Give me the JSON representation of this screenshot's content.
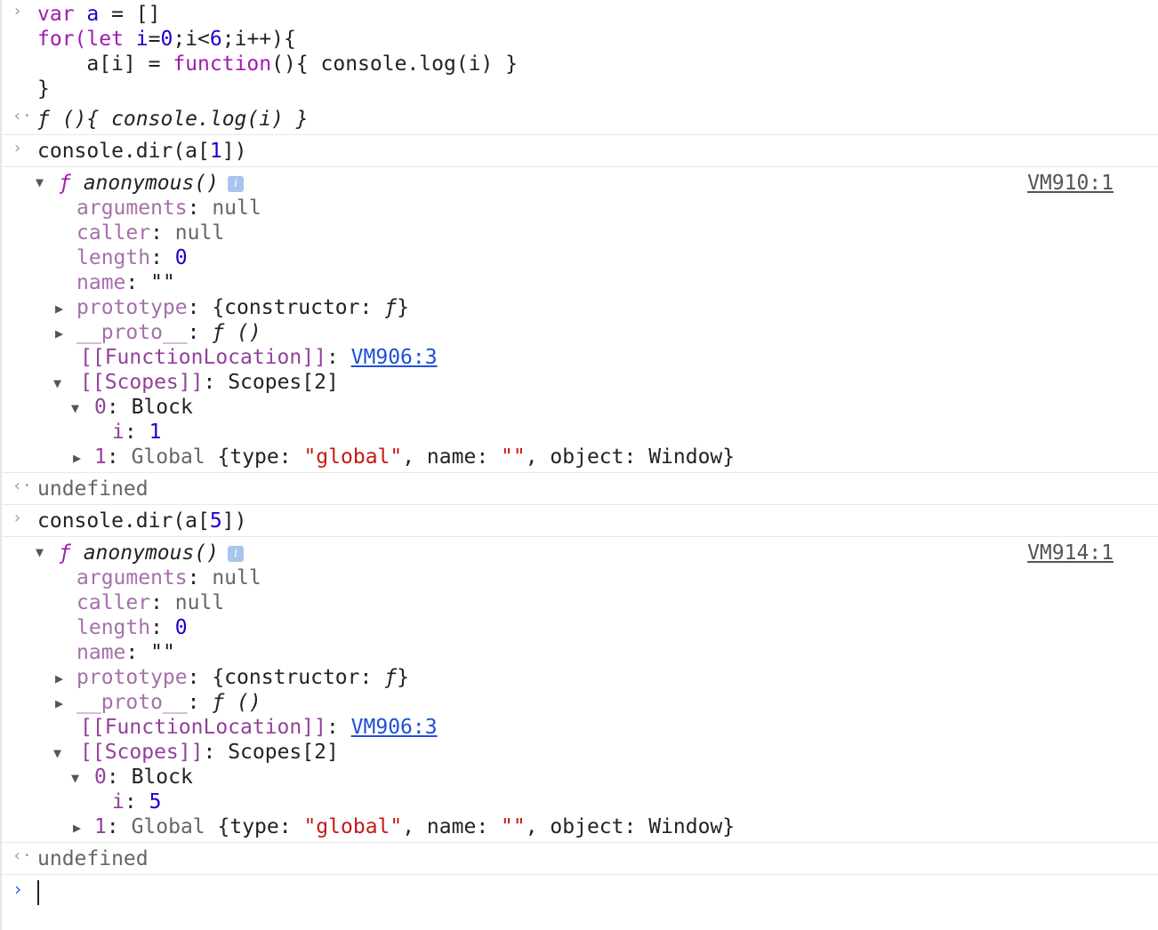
{
  "input1": {
    "l1": {
      "a": "var",
      "b": " a",
      "c": " = []"
    },
    "l2": {
      "a": "for(",
      "b": "let",
      "c": " i",
      "d": "=",
      "e": "0",
      "f": ";i<",
      "g": "6",
      "h": ";i++){"
    },
    "l3": {
      "a": "    a[i] = ",
      "b": "function",
      "c": "(){ console.log(i) }"
    },
    "l4": "}"
  },
  "result1": "ƒ (){ console.log(i) }",
  "inputs": {
    "dir1": {
      "a": "console.dir(a[",
      "b": "1",
      "c": "])"
    },
    "dir5": {
      "a": "console.dir(a[",
      "b": "5",
      "c": "])"
    }
  },
  "entries": [
    {
      "source": "VM910:1",
      "header": {
        "f": "ƒ",
        "name": " anonymous()"
      },
      "arguments": {
        "k": "arguments",
        "v": "null"
      },
      "caller": {
        "k": "caller",
        "v": "null"
      },
      "length": {
        "k": "length",
        "v": "0"
      },
      "name": {
        "k": "name",
        "v": "\"\""
      },
      "prototype": {
        "k": "prototype",
        "v": "{constructor: ",
        "f": "ƒ",
        "e": "}"
      },
      "proto": {
        "k": "__proto__",
        "v": "ƒ ()"
      },
      "location": {
        "k": "[[FunctionLocation]]",
        "v": "VM906:3"
      },
      "scopes": {
        "k": "[[Scopes]]",
        "v": "Scopes[2]"
      },
      "block": {
        "k": "0",
        "v": "Block"
      },
      "ivar": {
        "k": "i",
        "v": "1"
      },
      "global": {
        "k": "1",
        "t": "Global",
        "a": "{type: ",
        "b": "\"global\"",
        "c": ", name: ",
        "d": "\"\"",
        "e": ", object: Window}"
      }
    },
    {
      "source": "VM914:1",
      "header": {
        "f": "ƒ",
        "name": " anonymous()"
      },
      "arguments": {
        "k": "arguments",
        "v": "null"
      },
      "caller": {
        "k": "caller",
        "v": "null"
      },
      "length": {
        "k": "length",
        "v": "0"
      },
      "name": {
        "k": "name",
        "v": "\"\""
      },
      "prototype": {
        "k": "prototype",
        "v": "{constructor: ",
        "f": "ƒ",
        "e": "}"
      },
      "proto": {
        "k": "__proto__",
        "v": "ƒ ()"
      },
      "location": {
        "k": "[[FunctionLocation]]",
        "v": "VM906:3"
      },
      "scopes": {
        "k": "[[Scopes]]",
        "v": "Scopes[2]"
      },
      "block": {
        "k": "0",
        "v": "Block"
      },
      "ivar": {
        "k": "i",
        "v": "5"
      },
      "global": {
        "k": "1",
        "t": "Global",
        "a": "{type: ",
        "b": "\"global\"",
        "c": ", name: ",
        "d": "\"\"",
        "e": ", object: Window}"
      }
    }
  ],
  "undefined_label": "undefined",
  "icons": {
    "input_prompt": "›",
    "result_prompt": "‹·",
    "expand": "▼",
    "collapsed": "▶",
    "info": "i"
  }
}
